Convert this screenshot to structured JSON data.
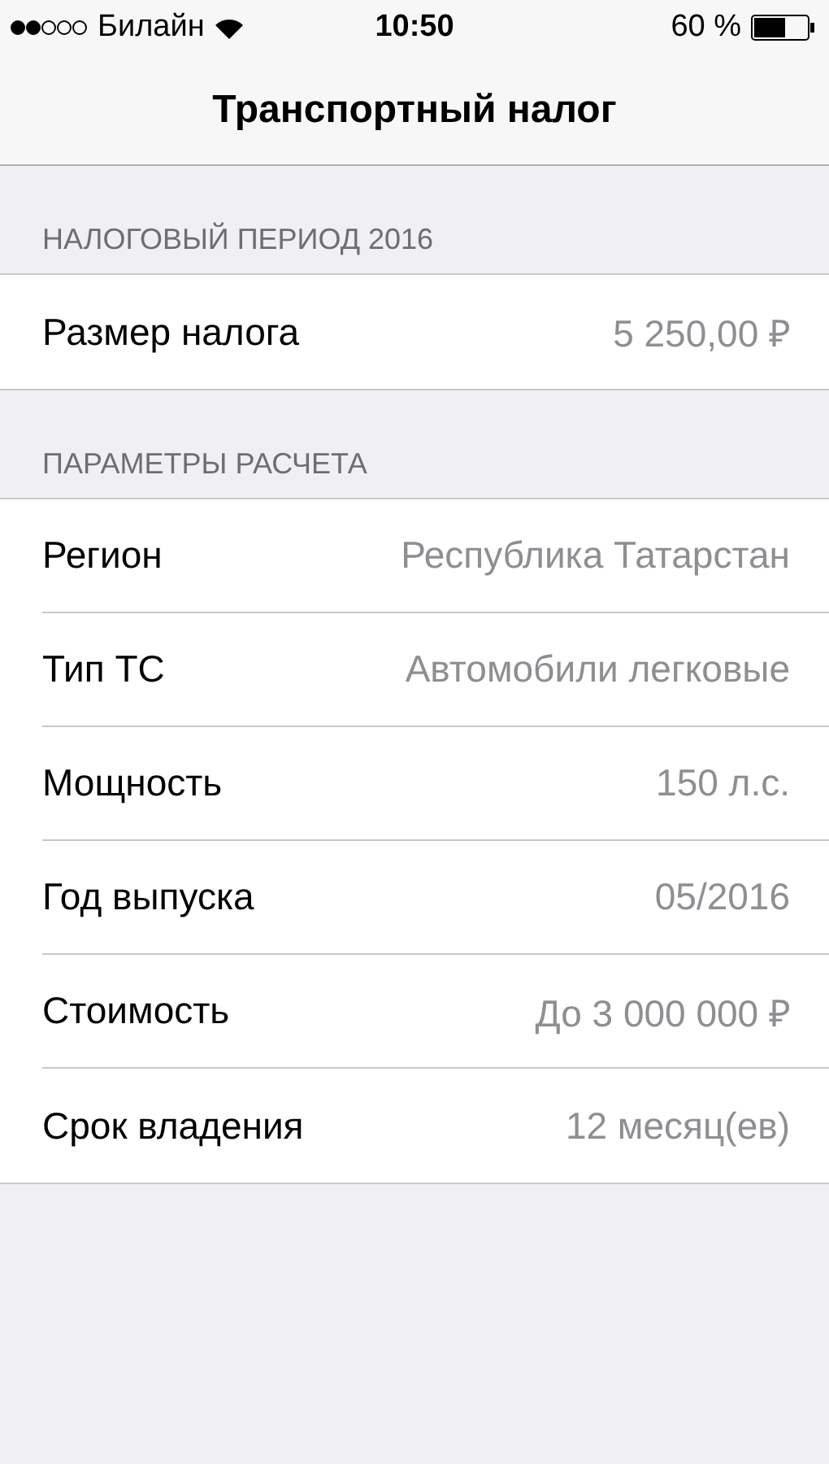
{
  "status_bar": {
    "carrier": "Билайн",
    "time": "10:50",
    "battery": "60 %"
  },
  "nav": {
    "title": "Транспортный налог"
  },
  "sections": [
    {
      "header": "НАЛОГОВЫЙ ПЕРИОД 2016",
      "rows": [
        {
          "label": "Размер налога",
          "value": "5 250,00 ₽"
        }
      ]
    },
    {
      "header": "ПАРАМЕТРЫ РАСЧЕТА",
      "rows": [
        {
          "label": "Регион",
          "value": "Республика Татарстан"
        },
        {
          "label": "Тип ТС",
          "value": "Автомобили легковые"
        },
        {
          "label": "Мощность",
          "value": "150 л.с."
        },
        {
          "label": "Год выпуска",
          "value": "05/2016"
        },
        {
          "label": "Стоимость",
          "value": "До 3 000 000 ₽"
        },
        {
          "label": "Срок владения",
          "value": "12 месяц(ев)"
        }
      ]
    }
  ]
}
